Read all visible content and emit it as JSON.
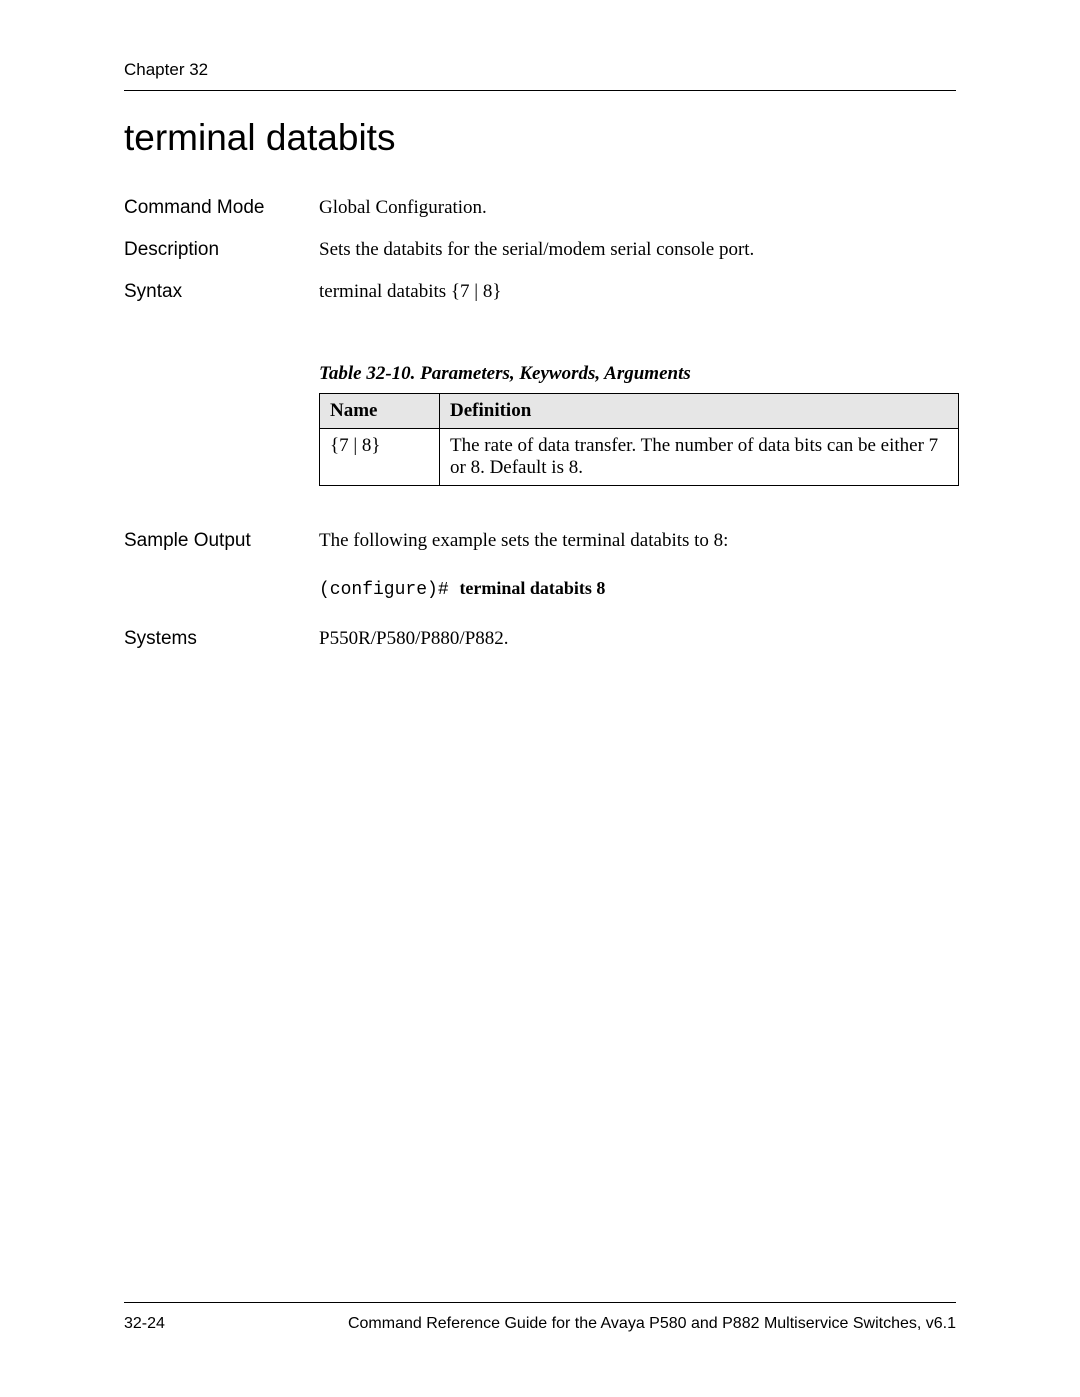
{
  "header": {
    "chapter": "Chapter 32"
  },
  "title": "terminal databits",
  "rows": {
    "commandMode": {
      "label": "Command Mode",
      "value": "Global Configuration."
    },
    "description": {
      "label": "Description",
      "value": "Sets the databits for the serial/modem serial console port."
    },
    "syntax": {
      "label": "Syntax",
      "value": "terminal databits {7 | 8}"
    }
  },
  "table": {
    "caption": "Table 32-10.  Parameters, Keywords, Arguments",
    "headers": {
      "name": "Name",
      "definition": "Definition"
    },
    "row1": {
      "name": "{7 | 8}",
      "definition": "The rate of data transfer. The number of data bits can be either 7 or 8. Default is 8."
    }
  },
  "sampleOutput": {
    "label": "Sample Output",
    "text": "The following example sets the terminal databits to 8:",
    "prompt": "(configure)# ",
    "command": "terminal databits 8"
  },
  "systems": {
    "label": "Systems",
    "value": "P550R/P580/P880/P882."
  },
  "footer": {
    "pageNum": "32-24",
    "docTitle": "Command Reference Guide for the Avaya P580 and P882 Multiservice Switches, v6.1"
  }
}
